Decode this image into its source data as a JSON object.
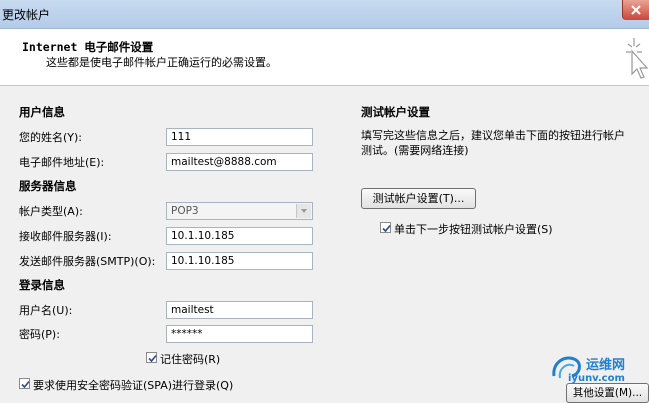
{
  "window": {
    "title": "更改帐户"
  },
  "header": {
    "title": "Internet 电子邮件设置",
    "subtitle": "这些都是使电子邮件帐户正确运行的必需设置。"
  },
  "user_info": {
    "section": "用户信息",
    "name_label": "您的姓名(Y):",
    "name_value": "111",
    "email_label": "电子邮件地址(E):",
    "email_value": "mailtest@8888.com"
  },
  "server_info": {
    "section": "服务器信息",
    "type_label": "帐户类型(A):",
    "type_value": "POP3",
    "incoming_label": "接收邮件服务器(I):",
    "incoming_value": "10.1.10.185",
    "outgoing_label": "发送邮件服务器(SMTP)(O):",
    "outgoing_value": "10.1.10.185"
  },
  "login_info": {
    "section": "登录信息",
    "user_label": "用户名(U):",
    "user_value": "mailtest",
    "pass_label": "密码(P):",
    "pass_value": "******",
    "remember_label": "记住密码(R)",
    "remember_checked": true,
    "spa_label": "要求使用安全密码验证(SPA)进行登录(Q)",
    "spa_checked": true
  },
  "test_settings": {
    "section": "测试帐户设置",
    "desc_line1": "填写完这些信息之后，建议您单击下面的按钮进行帐户",
    "desc_line2": "测试。(需要网络连接)",
    "test_button": "测试帐户设置(T)...",
    "next_test_label": "单击下一步按钮测试帐户设置(S)",
    "next_test_checked": true
  },
  "more_button": "其他设置(M)...",
  "watermark": {
    "cn": "运维网",
    "url": "iyunv.com"
  },
  "colors": {
    "titlebar": "#b9cfeb",
    "check": "#2a4c8f",
    "watermark": "#1f7fd0"
  }
}
